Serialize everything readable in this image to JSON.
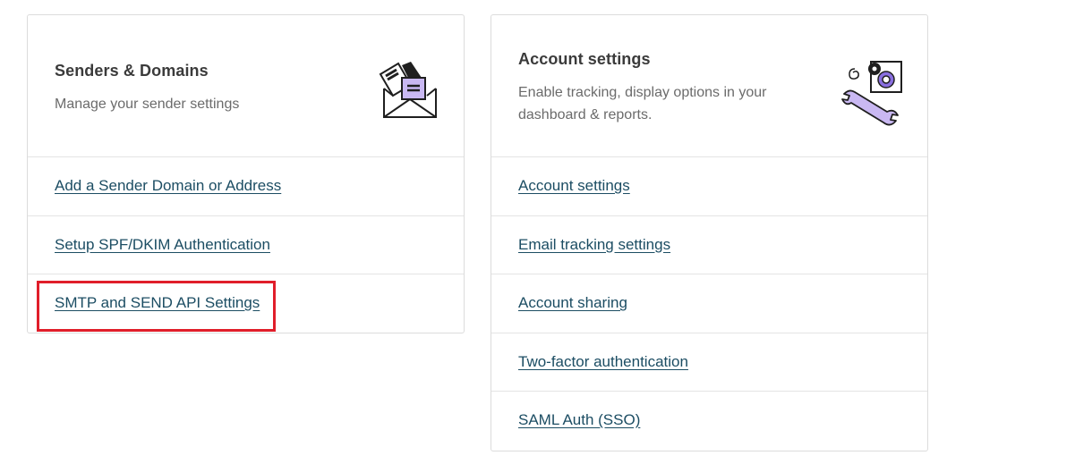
{
  "senders_card": {
    "title": "Senders & Domains",
    "description": "Manage your sender settings",
    "illustration_icon": "envelope-letters-icon",
    "links": [
      {
        "label": "Add a Sender Domain or Address"
      },
      {
        "label": "Setup SPF/DKIM Authentication"
      },
      {
        "label": "SMTP and SEND API Settings",
        "highlighted": true
      }
    ]
  },
  "account_card": {
    "title": "Account settings",
    "description": "Enable tracking, display options in your dashboard & reports.",
    "illustration_icon": "wrench-gear-icon",
    "links": [
      {
        "label": "Account settings"
      },
      {
        "label": "Email tracking settings"
      },
      {
        "label": "Account sharing"
      },
      {
        "label": "Two-factor authentication"
      },
      {
        "label": "SAML Auth (SSO)"
      }
    ]
  },
  "colors": {
    "link": "#1c4d63",
    "highlight": "#e01e2a",
    "illustration_accent": "#c9b8f2"
  }
}
